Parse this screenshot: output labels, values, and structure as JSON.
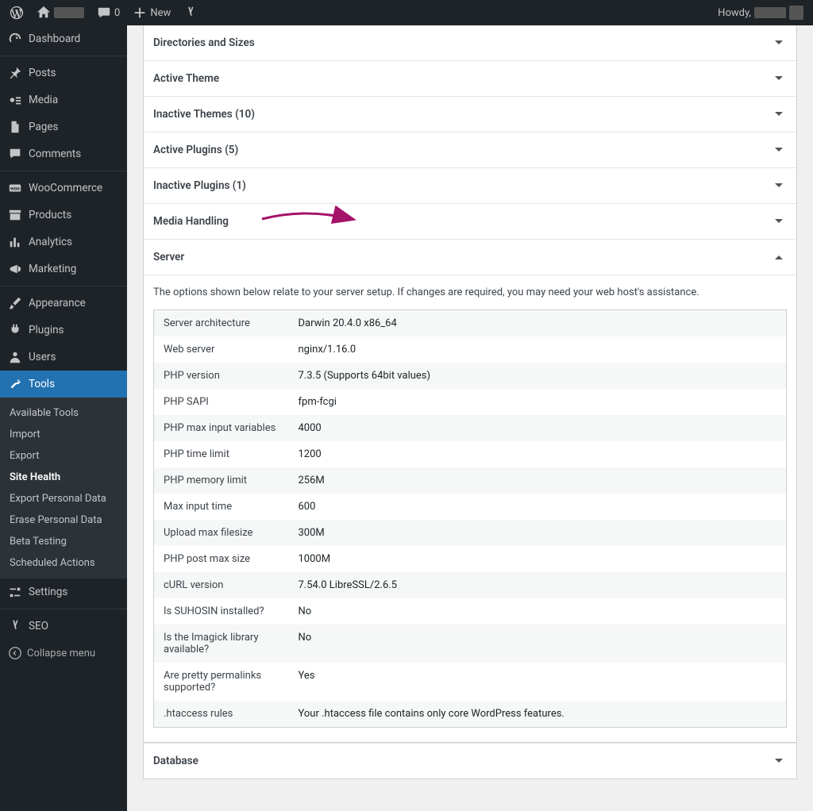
{
  "adminbar": {
    "new": "New",
    "comments": "0",
    "howdy": "Howdy,"
  },
  "menu": {
    "dashboard": "Dashboard",
    "posts": "Posts",
    "media": "Media",
    "pages": "Pages",
    "comments": "Comments",
    "woocommerce": "WooCommerce",
    "products": "Products",
    "analytics": "Analytics",
    "marketing": "Marketing",
    "appearance": "Appearance",
    "plugins": "Plugins",
    "users": "Users",
    "tools": "Tools",
    "tools_sub": {
      "available": "Available Tools",
      "import": "Import",
      "export": "Export",
      "site_health": "Site Health",
      "export_pd": "Export Personal Data",
      "erase_pd": "Erase Personal Data",
      "beta": "Beta Testing",
      "scheduled": "Scheduled Actions"
    },
    "settings": "Settings",
    "seo": "SEO",
    "collapse": "Collapse menu"
  },
  "panels": {
    "dirs": "Directories and Sizes",
    "active_theme": "Active Theme",
    "inactive_themes": "Inactive Themes (10)",
    "active_plugins": "Active Plugins (5)",
    "inactive_plugins": "Inactive Plugins (1)",
    "media": "Media Handling",
    "server": "Server",
    "database": "Database"
  },
  "server": {
    "desc": "The options shown below relate to your server setup. If changes are required, you may need your web host's assistance.",
    "rows": [
      {
        "k": "Server architecture",
        "v": "Darwin 20.4.0 x86_64"
      },
      {
        "k": "Web server",
        "v": "nginx/1.16.0"
      },
      {
        "k": "PHP version",
        "v": "7.3.5 (Supports 64bit values)"
      },
      {
        "k": "PHP SAPI",
        "v": "fpm-fcgi"
      },
      {
        "k": "PHP max input variables",
        "v": "4000"
      },
      {
        "k": "PHP time limit",
        "v": "1200"
      },
      {
        "k": "PHP memory limit",
        "v": "256M"
      },
      {
        "k": "Max input time",
        "v": "600"
      },
      {
        "k": "Upload max filesize",
        "v": "300M"
      },
      {
        "k": "PHP post max size",
        "v": "1000M"
      },
      {
        "k": "cURL version",
        "v": "7.54.0 LibreSSL/2.6.5"
      },
      {
        "k": "Is SUHOSIN installed?",
        "v": "No"
      },
      {
        "k": "Is the Imagick library available?",
        "v": "No"
      },
      {
        "k": "Are pretty permalinks supported?",
        "v": "Yes"
      },
      {
        "k": ".htaccess rules",
        "v": "Your .htaccess file contains only core WordPress features."
      }
    ]
  }
}
